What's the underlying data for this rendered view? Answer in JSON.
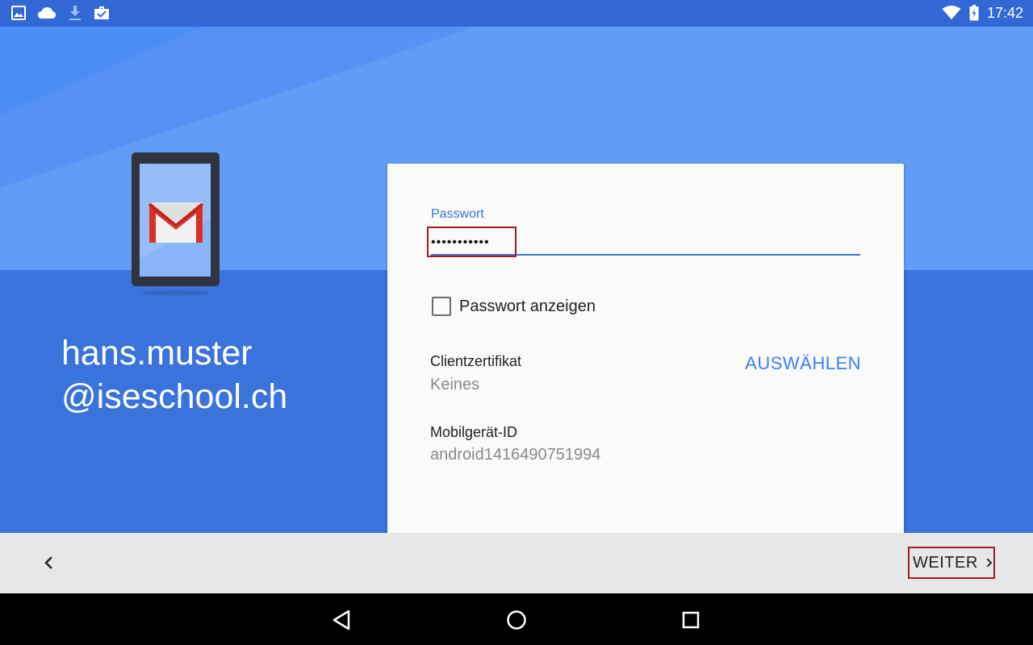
{
  "status_bar": {
    "time": "17:42",
    "left_icons": [
      "image-icon",
      "cloud-icon",
      "download-icon",
      "work-briefcase-icon"
    ],
    "right_icons": [
      "wifi-icon",
      "battery-icon"
    ]
  },
  "account": {
    "line1": "hans.muster",
    "line2": "@iseschool.ch"
  },
  "form": {
    "password_label": "Passwort",
    "password_value": "•••••••••••",
    "show_password_label": "Passwort anzeigen",
    "show_password_checked": false,
    "client_cert_label": "Clientzertifikat",
    "client_cert_value": "Keines",
    "select_label": "AUSWÄHLEN",
    "device_id_label": "Mobilgerät-ID",
    "device_id_value": "android1416490751994"
  },
  "footer": {
    "next_label": "WEITER"
  },
  "colors": {
    "status_bar": "#3367d6",
    "accent": "#3d72d8",
    "link": "#3d82e8",
    "highlight_border": "#a01c1c",
    "background_light": "#639cf7",
    "background_dark": "#3b73dc"
  },
  "nav_bar": {
    "icons": [
      "back-triangle-icon",
      "home-circle-icon",
      "recents-square-icon"
    ]
  }
}
